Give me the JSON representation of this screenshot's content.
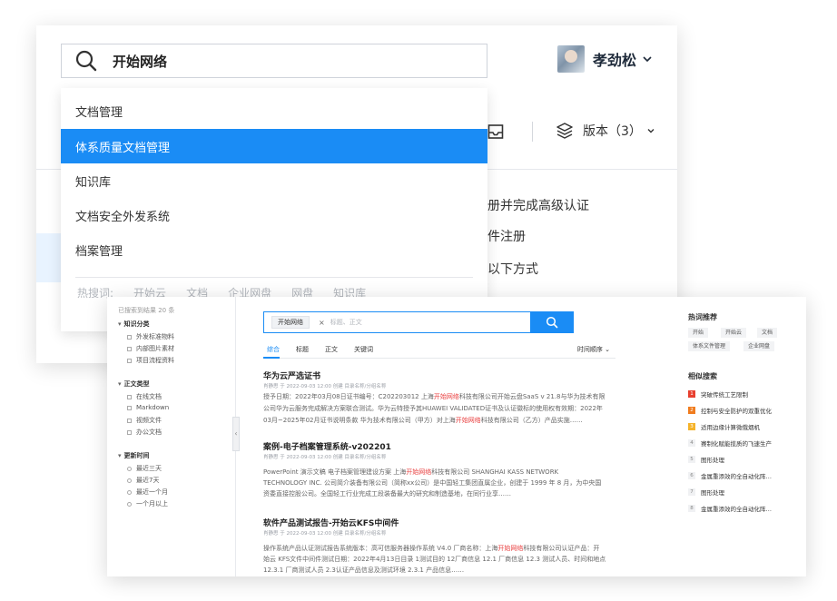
{
  "back": {
    "search_query": "开始网络",
    "user_name": "孝劲松",
    "version_label": "版本（3）",
    "lines": [
      "册并完成高级认证",
      "件注册",
      "以下方式"
    ]
  },
  "dropdown": {
    "items": [
      "文档管理",
      "体系质量文档管理",
      "知识库",
      "文档安全外发系统",
      "档案管理"
    ],
    "active_index": 1,
    "hot_label": "热搜词:",
    "hot_terms": [
      "开始云",
      "文档",
      "企业网盘",
      "网盘",
      "知识库"
    ]
  },
  "front": {
    "left_panel": {
      "result_count": "已搜索到结果 20 条",
      "sections": [
        {
          "title": "知识分类",
          "items": [
            "外发标准物料",
            "内部图片素材",
            "项目流程资料"
          ]
        },
        {
          "title": "正文类型",
          "items": [
            "在线文档",
            "Markdown",
            "视频文件",
            "办公文档"
          ]
        },
        {
          "title": "更新时间",
          "items": [
            "最近三天",
            "最近7天",
            "最近一个月",
            "一个月以上"
          ]
        }
      ]
    },
    "search": {
      "tag": "开始网络",
      "placeholder": "标题、正文"
    },
    "tabs": [
      "综合",
      "标题",
      "正文",
      "关键词"
    ],
    "sort_label": "时间顺序",
    "results": [
      {
        "title": "华为云严选证书",
        "meta": "肖静思 于 2022-09-03 12:00 创建     目录名称/分组名称",
        "line1_pre": "授予日期：2022年03月08日证书编号：C202203012 上海",
        "line1_hl": "开始网络",
        "line1_post": "科技有限公司开始云盘SaaS v 21.8与华为技术有限",
        "line2": "公司华为云服务完成解决方案联合测试。华为云特授予其HUAWEI VALIDATED证书及认证徽标的使用权有效期：2022年",
        "line3_pre": "03月~2025年02月证书说明条款 华为技术有限公司（甲方）对上海",
        "line3_hl": "开始网络",
        "line3_post": "科技有限公司（乙方）产品实施……"
      },
      {
        "title": "案例-电子档案管理系统-v202201",
        "meta": "肖静思 于 2022-09-03 12:00 创建     目录名称/分组名称",
        "line1_pre": "PowerPoint 演示文稿 电子档案管理建设方案 上海",
        "line1_hl": "开始网络",
        "line1_post": "科技有限公司 SHANGHAI KASS NETWORK",
        "line2": "TECHNOLOGY INC. 公司简介装备有限公司（简称xx公司）是中国轻工集团直属企业，创建于 1999 年 8 月，为中央国",
        "line3_pre": "资委直接控股公司。全国轻工行业完成工段装备最大的研究和制造基地，在同行业享……",
        "line3_hl": "",
        "line3_post": ""
      },
      {
        "title": "软件产品测试报告-开始云KFS中间件",
        "meta": "肖静思 于 2022-09-03 12:00 创建     目录名称/分组名称",
        "line1_pre": "操作系统产品认证测试报告系统版本：高可信服务器操作系统 V4.0 厂商名称：上海",
        "line1_hl": "开始网络",
        "line1_post": "科技有限公司认证产品：开",
        "line2": "始云 KFS文件中间件测试日期：2022年4月13日目录 1测试目的 12厂商信息 12.1 厂商信息  12.3 测试人员、时间和地点",
        "line3_pre": "12.3.1 厂商测试人员 2.3认证产品信息及测试环境 2.3.1 产品信息……",
        "line3_hl": "",
        "line3_post": ""
      }
    ],
    "hot_title": "热词推荐",
    "hot_tags": [
      "开始",
      "开始云",
      "文档",
      "体系文件管理",
      "企业网盘"
    ],
    "similar_title": "相似搜索",
    "similar_items": [
      "突破传统工艺限制",
      "控制与安全防护的双重优化",
      "适用边缘计算微俄烟机",
      "赛制化赋能揽质的飞速生产",
      "图形处理",
      "金属重添效的全自动化阵…",
      "图形处理",
      "金属重添效的全自动化阵…"
    ]
  },
  "colors": {
    "accent": "#1a8cf5",
    "highlight": "#e94040"
  }
}
